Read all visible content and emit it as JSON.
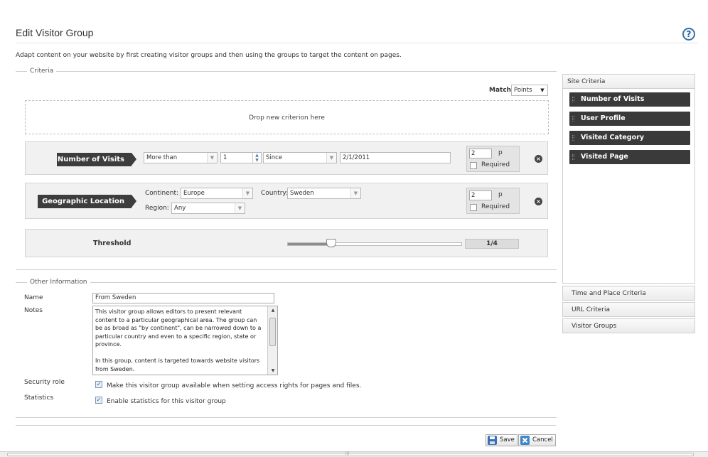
{
  "header": {
    "title": "Edit Visitor Group",
    "help_icon": "?",
    "intro": "Adapt content on your website by first creating visitor groups and then using the groups to target the content on pages."
  },
  "criteria": {
    "legend": "Criteria",
    "match_label": "Match",
    "match_value": "Points",
    "dropzone_text": "Drop new criterion here",
    "rows": [
      {
        "tag": "Number of Visits",
        "comparison": "More than",
        "count": "1",
        "period": "Since",
        "date": "2/1/2011",
        "points": "2",
        "points_unit": "p",
        "required_label": "Required",
        "required": false
      },
      {
        "tag": "Geographic Location",
        "continent_label": "Continent:",
        "continent": "Europe",
        "country_label": "Country:",
        "country": "Sweden",
        "region_label": "Region:",
        "region": "Any",
        "points": "2",
        "points_unit": "p",
        "required_label": "Required",
        "required": false
      }
    ],
    "threshold": {
      "label": "Threshold",
      "value_text": "1/4",
      "fraction": 0.25
    }
  },
  "other_info": {
    "legend": "Other Information",
    "name_label": "Name",
    "name_value": "From Sweden",
    "notes_label": "Notes",
    "notes_value": "This visitor group allows editors to present relevant content to a particular geographical area. The group can be as broad as \"by continent\", can be narrowed down to a particular country and even to a specific region, state or province.\n\nIn this group, content is targeted towards website visitors from Sweden.",
    "security_label": "Security role",
    "security_text": "Make this visitor group available when setting access rights for pages and files.",
    "security_checked": true,
    "statistics_label": "Statistics",
    "statistics_text": "Enable statistics for this visitor group",
    "statistics_checked": true
  },
  "actions": {
    "save_label": "Save",
    "cancel_label": "Cancel"
  },
  "side_panel": {
    "header": "Site Criteria",
    "items": [
      "Number of Visits",
      "User Profile",
      "Visited Category",
      "Visited Page"
    ],
    "tabs": [
      "Time and Place Criteria",
      "URL Criteria",
      "Visitor Groups"
    ]
  },
  "colors": {
    "accent_dark": "#3d3d3d",
    "help_blue": "#3a72a8",
    "save_icon_blue": "#3b6fb3",
    "cancel_icon_blue": "#3f86c9"
  },
  "icons": {
    "help": "help-icon",
    "remove": "remove-icon",
    "save": "save-icon",
    "cancel": "cancel-icon"
  }
}
